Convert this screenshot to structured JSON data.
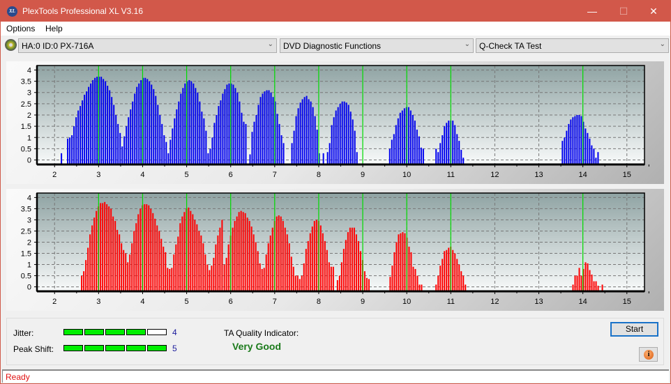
{
  "window": {
    "title": "PlexTools Professional XL V3.16",
    "logo": "XL",
    "controls": [
      "minimize",
      "maximize",
      "close"
    ]
  },
  "menu": {
    "items": [
      "Options",
      "Help"
    ]
  },
  "toolbar": {
    "drive": "HA:0 ID:0  PX-716A",
    "function_group": "DVD Diagnostic Functions",
    "test": "Q-Check TA Test"
  },
  "colors": {
    "titlebar": "#d2584a",
    "upper_bars": "#0000ee",
    "lower_bars": "#ff0000",
    "marker": "#00dd00",
    "meter_on": "#00ee00"
  },
  "chart_data": [
    {
      "type": "bar",
      "name": "upper-chart",
      "bar_color": "#0000ee",
      "x_ticks": [
        2,
        3,
        4,
        5,
        6,
        7,
        8,
        9,
        10,
        11,
        12,
        13,
        14,
        15
      ],
      "y_ticks": [
        "0",
        "0.5",
        "1",
        "1.5",
        "2",
        "2.5",
        "3",
        "3.5",
        "4"
      ],
      "xlim": [
        1.6,
        15.4
      ],
      "ylim": [
        -0.2,
        4.2
      ],
      "markers": [
        3,
        4,
        5,
        6,
        7,
        8,
        9,
        10,
        11,
        14
      ],
      "grid": true,
      "bar_step": 0.0476,
      "groups": [
        {
          "start": 2.14,
          "values": [
            0.3,
            0,
            0,
            0.95,
            1.0,
            1.1,
            1.5,
            1.9,
            2.2,
            2.4,
            2.65,
            2.9,
            3.05,
            3.25,
            3.4,
            3.55,
            3.65,
            3.7,
            3.7,
            3.7,
            3.6,
            3.5,
            3.3,
            3.1,
            2.8,
            2.45,
            2.0,
            1.6,
            1.2,
            0.6,
            1.05,
            1.5,
            1.9,
            2.25,
            2.6,
            2.95,
            3.25,
            3.4,
            3.55,
            3.65,
            3.65,
            3.6,
            3.5,
            3.35,
            3.15,
            2.85,
            2.45,
            2.0,
            1.6,
            1.1,
            0.8,
            0.3,
            0.9,
            1.4,
            1.85,
            2.25,
            2.6,
            2.95,
            3.2,
            3.4,
            3.5,
            3.55,
            3.5,
            3.4,
            3.2,
            3.0,
            2.6,
            2.15,
            1.85,
            1.3,
            0.3
          ]
        },
        {
          "start": 5.52,
          "values": [
            0.5,
            1.0,
            1.65,
            2.0,
            2.4,
            2.65,
            2.95,
            3.15,
            3.35,
            3.4,
            3.4,
            3.35,
            3.2,
            3.0,
            2.6,
            2.1,
            1.7,
            1.6,
            0,
            0.25,
            1.25,
            1.7,
            2.0,
            2.45,
            2.8,
            2.95,
            3.05,
            3.1,
            3.1,
            3.0,
            2.8,
            2.6,
            2.05,
            1.6,
            1.1,
            0.75,
            0.0,
            0.0,
            0.0,
            0.75,
            1.3,
            1.95,
            2.3,
            2.55,
            2.7,
            2.8,
            2.85,
            2.7,
            2.6,
            2.35,
            1.95,
            1.35,
            0.3,
            0.0,
            0.3,
            0.0,
            0.35,
            0.75,
            1.55,
            1.9,
            2.2,
            2.35,
            2.5,
            2.6,
            2.6,
            2.55,
            2.45,
            2.15,
            1.8,
            1.3,
            0.35
          ]
        },
        {
          "start": 9.55,
          "values": [
            0.0,
            0.5,
            0.9,
            1.15,
            1.55,
            1.85,
            2.1,
            2.2,
            2.3,
            2.35,
            2.35,
            2.2,
            2.0,
            1.75,
            1.35,
            1.05,
            0.55,
            0.5
          ]
        },
        {
          "start": 10.65,
          "values": [
            0.5,
            0.35,
            0.75,
            1.1,
            1.5,
            1.65,
            1.75,
            1.75,
            1.75,
            1.55,
            1.15,
            0.85,
            0.45,
            0.1
          ]
        },
        {
          "start": 13.52,
          "values": [
            0.85,
            1.0,
            1.3,
            1.6,
            1.8,
            1.9,
            1.95,
            2.0,
            2.0,
            1.95,
            1.7,
            1.4,
            1.2,
            0.95,
            0.65,
            0.5,
            0.1,
            0.35
          ]
        }
      ]
    },
    {
      "type": "bar",
      "name": "lower-chart",
      "bar_color": "#ff0000",
      "x_ticks": [
        2,
        3,
        4,
        5,
        6,
        7,
        8,
        9,
        10,
        11,
        12,
        13,
        14,
        15
      ],
      "y_ticks": [
        "0",
        "0.5",
        "1",
        "1.5",
        "2",
        "2.5",
        "3",
        "3.5",
        "4"
      ],
      "xlim": [
        1.6,
        15.4
      ],
      "ylim": [
        -0.2,
        4.2
      ],
      "markers": [
        3,
        4,
        5,
        6,
        7,
        8,
        9,
        10,
        11,
        14
      ],
      "grid": true,
      "bar_step": 0.0476,
      "groups": [
        {
          "start": 2.6,
          "values": [
            0.5,
            0.7,
            1.2,
            1.75,
            2.35,
            2.75,
            3.1,
            3.4,
            3.6,
            3.75,
            3.75,
            3.8,
            3.7,
            3.6,
            3.5,
            3.15,
            2.95,
            2.55,
            2.35,
            1.95,
            1.65,
            1.5,
            1.1,
            1.45,
            1.95,
            2.5,
            2.85,
            3.25,
            3.5,
            3.65,
            3.7,
            3.7,
            3.65,
            3.5,
            3.3,
            3.05,
            2.75,
            2.5,
            2.15,
            1.8,
            1.55,
            0.85,
            0.8,
            0.85,
            1.45,
            1.9,
            2.25,
            2.85,
            3.15,
            3.35,
            3.5,
            3.55,
            3.4,
            3.25,
            3.0,
            2.8,
            2.5,
            2.3,
            1.95,
            1.45,
            1.0,
            0.75,
            0.95,
            1.3,
            1.9,
            2.3,
            2.65,
            3.0
          ]
        },
        {
          "start": 5.84,
          "values": [
            1.0,
            1.3,
            1.9,
            2.3,
            2.65,
            2.95,
            3.15,
            3.35,
            3.4,
            3.35,
            3.3,
            3.1,
            2.95,
            2.7,
            2.35,
            2.0,
            1.6,
            1.05,
            0.8,
            0.85,
            1.45,
            1.95,
            2.3,
            2.65,
            2.95,
            3.15,
            3.2,
            3.15,
            2.95,
            2.65,
            2.35,
            1.95,
            1.35,
            0.9,
            0.5,
            0.5,
            0.35,
            0.5,
            1.05,
            1.7,
            2.05,
            2.4,
            2.7,
            2.95,
            3.0,
            2.95,
            2.75,
            2.4,
            2.05,
            1.65,
            1.1,
            0.9,
            0.9,
            0.0,
            0.3,
            0.5,
            1.1,
            1.7,
            2.1,
            2.45,
            2.65,
            2.65,
            2.65,
            2.35,
            2.05,
            1.6,
            1.2,
            0.7,
            0.4,
            0.35
          ]
        },
        {
          "start": 9.56,
          "values": [
            0.0,
            0.45,
            0.95,
            1.55,
            2.0,
            2.35,
            2.4,
            2.45,
            2.4,
            2.2,
            1.8,
            1.55,
            0.9,
            0.8,
            0.5,
            0.1,
            0.1
          ]
        },
        {
          "start": 10.65,
          "values": [
            0.1,
            0.5,
            0.95,
            1.25,
            1.6,
            1.65,
            1.75,
            1.8,
            1.65,
            1.5,
            1.25,
            1.0,
            0.7,
            0.5,
            0.1
          ]
        },
        {
          "start": 13.76,
          "values": [
            0.1,
            0.5,
            0.5,
            0.85,
            0.5,
            0.8,
            1.1,
            1.05,
            0.75,
            0.55,
            0.25,
            0.25,
            0.05,
            0.0,
            0.1
          ]
        }
      ]
    }
  ],
  "results": {
    "jitter_label": "Jitter:",
    "jitter_value": "4",
    "jitter_score": 4,
    "peak_shift_label": "Peak Shift:",
    "peak_shift_value": "5",
    "peak_shift_score": 5,
    "meter_max": 5,
    "quality_label": "TA Quality Indicator:",
    "quality_value": "Very Good"
  },
  "buttons": {
    "start": "Start",
    "info": "i"
  },
  "status": {
    "text": "Ready"
  }
}
